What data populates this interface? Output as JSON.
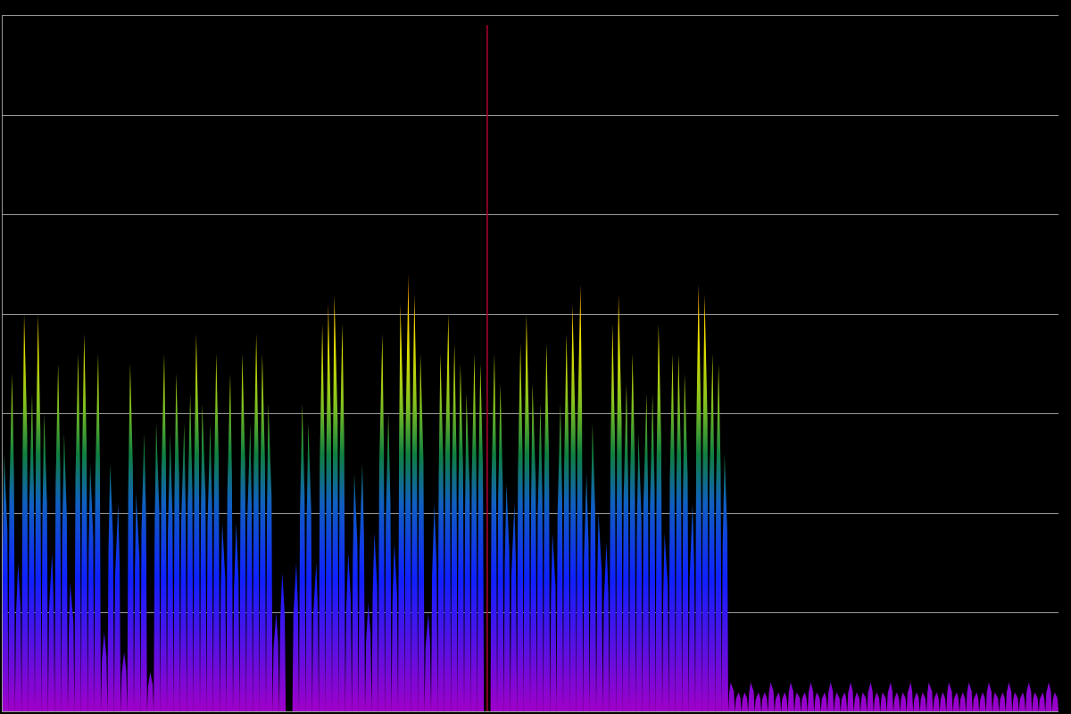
{
  "chart_data": {
    "type": "area",
    "title": "",
    "xlabel": "",
    "ylabel": "",
    "xlim": [
      0,
      160
    ],
    "ylim": [
      0,
      7
    ],
    "grid": true,
    "grid_y": [
      1,
      2,
      3,
      4,
      5,
      6,
      7
    ],
    "legend": "none",
    "series": [
      {
        "values": [
          2.6,
          3.4,
          1.5,
          4.0,
          3.2,
          4.0,
          3.0,
          1.6,
          3.5,
          2.8,
          1.3,
          3.6,
          3.8,
          2.5,
          3.6,
          0.8,
          2.5,
          2.1,
          0.6,
          3.5,
          2.2,
          2.8,
          0.4,
          2.9,
          3.6,
          2.8,
          3.4,
          2.9,
          3.2,
          3.8,
          3.1,
          2.9,
          3.6,
          1.9,
          3.4,
          1.9,
          3.6,
          2.9,
          3.8,
          3.6,
          3.1,
          1.0,
          1.4,
          0.0,
          1.5,
          3.1,
          2.9,
          1.5,
          3.9,
          4.1,
          4.2,
          3.9,
          1.6,
          2.4,
          2.5,
          1.1,
          1.8,
          3.8,
          3.0,
          1.7,
          4.1,
          4.4,
          4.2,
          3.6,
          1.0,
          2.1,
          3.6,
          4.0,
          3.7,
          3.5,
          3.2,
          3.6,
          3.5,
          6.9,
          3.6,
          3.3,
          2.3,
          2.1,
          3.7,
          4.0,
          3.3,
          3.1,
          3.7,
          1.8,
          3.1,
          3.8,
          4.1,
          4.3,
          2.4,
          2.9,
          2.0,
          1.7,
          3.9,
          4.2,
          3.3,
          3.6,
          2.8,
          3.2,
          3.2,
          3.9,
          1.8,
          3.6,
          3.6,
          3.4,
          2.1,
          4.3,
          4.2,
          3.6,
          3.5,
          2.6,
          0.3,
          0.2,
          0.2,
          0.3,
          0.2,
          0.2,
          0.3,
          0.2,
          0.2,
          0.3,
          0.2,
          0.2,
          0.3,
          0.2,
          0.2,
          0.3,
          0.2,
          0.2,
          0.3,
          0.2,
          0.2,
          0.3,
          0.2,
          0.2,
          0.3,
          0.2,
          0.2,
          0.3,
          0.2,
          0.2,
          0.3,
          0.2,
          0.2,
          0.3,
          0.2,
          0.2,
          0.3,
          0.2,
          0.2,
          0.3,
          0.2,
          0.2,
          0.3,
          0.2,
          0.2,
          0.3,
          0.2,
          0.2,
          0.3,
          0.2
        ]
      }
    ],
    "colors": {
      "low": "#a000c8",
      "mid_low": "#1020ff",
      "mid": "#108040",
      "mid_high": "#c8d800",
      "high": "#ffe000",
      "top": "#ff7000",
      "spike": "#b00030"
    }
  }
}
